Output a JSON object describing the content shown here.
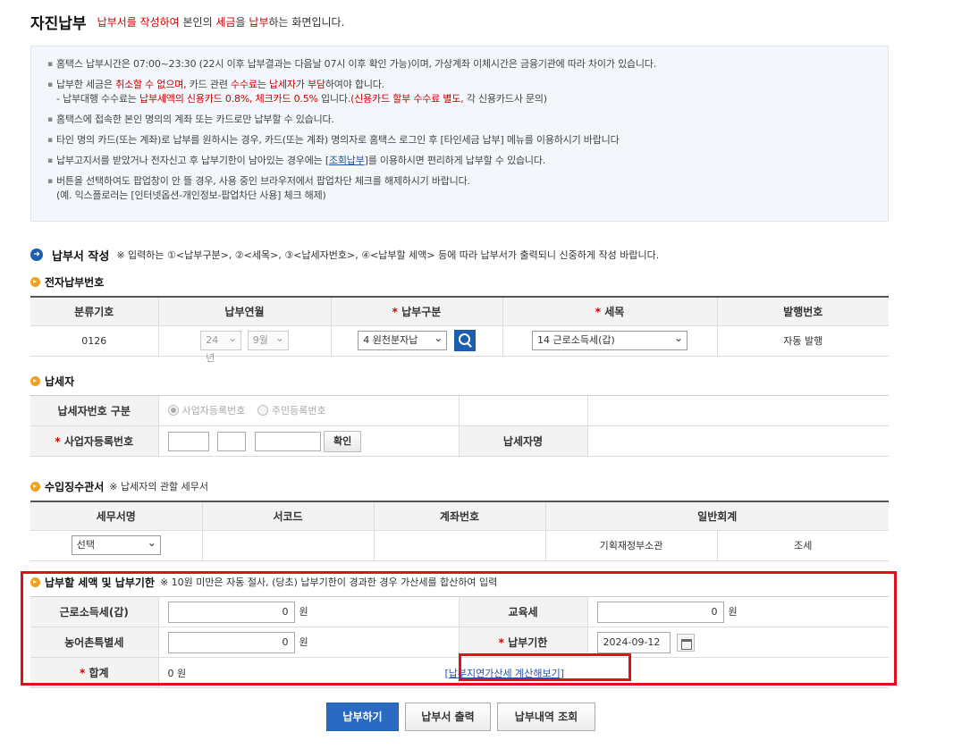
{
  "header": {
    "title": "자진납부",
    "desc_parts": [
      {
        "text": "납부서를 작성하여",
        "red": true
      },
      {
        "text": " 본인의 ",
        "red": false
      },
      {
        "text": "세금",
        "red": true
      },
      {
        "text": "을 ",
        "red": false
      },
      {
        "text": "납부",
        "red": true
      },
      {
        "text": "하는 화면입니다.",
        "red": false
      }
    ]
  },
  "notice": {
    "items": [
      [
        {
          "t": "홈택스 납부시간은 07:00~23:30 (22시 이후 납부결과는 다음날 07시 이후 확인 가능)이며, 가상계좌 이체시간은 금융기관에 따라 차이가 있습니다."
        }
      ],
      [
        {
          "t": "납부한 세금은 "
        },
        {
          "t": "취소할 수 없으며,",
          "r": 1
        },
        {
          "t": " 카드 관련 "
        },
        {
          "t": "수수료",
          "r": 1
        },
        {
          "t": "는 "
        },
        {
          "t": "납세자",
          "r": 1
        },
        {
          "t": "가 "
        },
        {
          "t": "부담",
          "r": 1
        },
        {
          "t": "하여야 합니다."
        },
        {
          "br": 1
        },
        {
          "t": "- 납부대행 수수료는 "
        },
        {
          "t": "납부세액의 신용카드 0.8%, 체크카드 0.5%",
          "r": 1
        },
        {
          "t": " 입니다."
        },
        {
          "t": "(신용카드 할부 수수료 별도,",
          "r": 1
        },
        {
          "t": " 각 신용카드사 문의)"
        }
      ],
      [
        {
          "t": "홈택스에 접속한 본인 명의의 계좌 또는 카드로만 납부할 수 있습니다."
        }
      ],
      [
        {
          "t": "타인 명의 카드(또는 계좌)로 납부를 원하시는 경우, 카드(또는 계좌) 명의자로 홈택스 로그인 후 [타인세금 납부] 메뉴를 이용하시기 바랍니다"
        }
      ],
      [
        {
          "t": "납부고지서를 받았거나 전자신고 후 납부기한이 남아있는 경우에는 ["
        },
        {
          "t": "조회납부",
          "link": 1
        },
        {
          "t": "]를 이용하시면 편리하게  납부할 수 있습니다."
        }
      ],
      [
        {
          "t": "버튼을 선택하여도 팝업창이 안 뜰 경우, 사용 중인 브라우저에서 팝업차단 체크를 해제하시기 바랍니다."
        },
        {
          "br": 1
        },
        {
          "t": "(예. 익스플로러는 [인터넷옵션-개인정보-팝업차단 사용] 체크 해제)"
        }
      ]
    ]
  },
  "section_main": {
    "title": "납부서 작성",
    "note": "※ 입력하는 ①<납부구분>, ②<세목>, ③<납세자번호>, ④<납부할 세액> 등에 따라 납부서가 출력되니 신중하게 작성 바랍니다."
  },
  "e_number": {
    "title": "전자납부번호",
    "headers": [
      "분류기호",
      "납부연월",
      "납부구분",
      "세목",
      "발행번호"
    ],
    "required_marks": [
      "",
      "",
      "*",
      "*",
      ""
    ],
    "row": {
      "code": "0126",
      "year": "24년",
      "month": "9월",
      "pay_type": "4 원천분자납",
      "tax_item": "14 근로소득세(갑)",
      "issue_no": "자동 발행"
    }
  },
  "taxpayer": {
    "title": "납세자",
    "type_label": "납세자번호 구분",
    "radio_business": "사업자등록번호",
    "radio_resident": "주민등록번호",
    "reg_label": "사업자등록번호",
    "confirm_btn": "확인",
    "name_label": "납세자명"
  },
  "office": {
    "title": "수입징수관서",
    "note": "※ 납세자의 관할 세무서",
    "headers": [
      "세무서명",
      "서코드",
      "계좌번호",
      "일반회계"
    ],
    "select": "선택",
    "ministry": "기획재정부소관",
    "tax_kind": "조세"
  },
  "amount": {
    "title": "납부할 세액 및 납부기한",
    "note": "※ 10원 미만은 자동 절사, (당초) 납부기한이 경과한 경우 가산세를 합산하여 입력",
    "income_tax_label": "근로소득세(갑)",
    "income_tax_value": "0",
    "edu_tax_label": "교육세",
    "edu_tax_value": "0",
    "rural_tax_label": "농어촌특별세",
    "rural_tax_value": "0",
    "due_label": "납부기한",
    "due_value": "2024-09-12",
    "total_label": "합계",
    "total_value": "0 원",
    "unit": "원",
    "calc_link": "[납부지연가산세 계산해보기]"
  },
  "buttons": {
    "pay": "납부하기",
    "print": "납부서 출력",
    "history": "납부내역 조회"
  }
}
